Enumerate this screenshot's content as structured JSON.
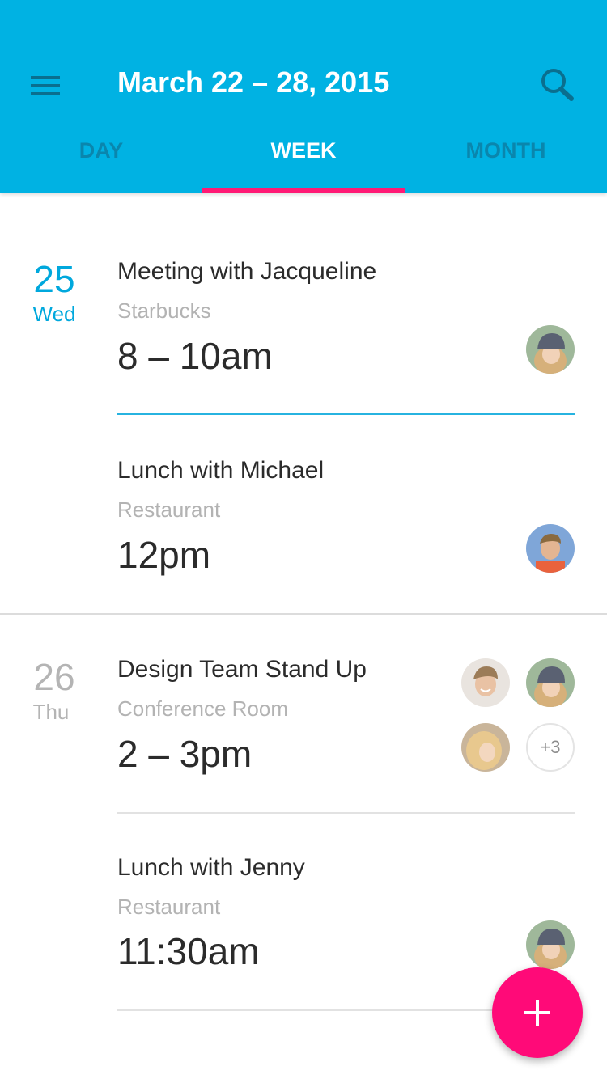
{
  "header": {
    "title": "March 22 – 28, 2015",
    "menu_icon": "menu-icon",
    "search_icon": "search-icon",
    "background_color": "#00b2e3"
  },
  "tabs": [
    {
      "label": "DAY",
      "active": false
    },
    {
      "label": "WEEK",
      "active": true
    },
    {
      "label": "MONTH",
      "active": false
    }
  ],
  "accent_color": "#ff1a75",
  "days": [
    {
      "number": "25",
      "weekday": "Wed",
      "current": true,
      "events": [
        {
          "title": "Meeting with Jacqueline",
          "place": "Starbucks",
          "time": "8 – 10am",
          "attendees": [
            "avatar-woman-beanie"
          ]
        },
        {
          "title": "Lunch with Michael",
          "place": "Restaurant",
          "time": "12pm",
          "attendees": [
            "avatar-man-blue"
          ]
        }
      ]
    },
    {
      "number": "26",
      "weekday": "Thu",
      "current": false,
      "events": [
        {
          "title": "Design Team Stand Up",
          "place": "Conference Room",
          "time": "2 – 3pm",
          "attendees": [
            "avatar-man-smiling",
            "avatar-woman-beanie",
            "avatar-woman-blonde"
          ],
          "more_count": "+3"
        },
        {
          "title": "Lunch with Jenny",
          "place": "Restaurant",
          "time": "11:30am",
          "attendees": [
            "avatar-woman-beanie"
          ]
        }
      ]
    }
  ],
  "fab": {
    "icon": "plus-icon",
    "color": "#ff0a78"
  }
}
